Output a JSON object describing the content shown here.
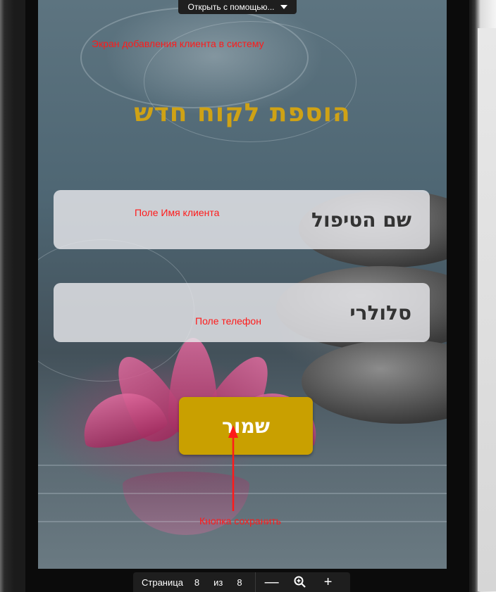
{
  "viewer": {
    "open_with_label": "Открыть с помощью...",
    "page_label": "Страница",
    "current_page": "8",
    "of_label": "из",
    "total_pages": "8",
    "zoom_out_symbol": "—",
    "zoom_in_symbol": "+",
    "zoom_icon_name": "zoom-icon",
    "caret_icon_name": "chevron-down-icon"
  },
  "app": {
    "title": "הוספת לקוח חדש",
    "name_field_placeholder": "שם הטיפול",
    "phone_field_placeholder": "סלולרי",
    "save_button_label": "שמור",
    "colors": {
      "title": "#cfa215",
      "button": "#c9a000",
      "field_bg": "#e8e8ec"
    }
  },
  "annotations": {
    "screen_caption": "Экран добавления клиента в систему",
    "name_field_caption": "Поле Имя клиента",
    "phone_field_caption": "Поле телефон",
    "save_button_caption": "Кнопка сохранить",
    "color": "#ff1a1a"
  }
}
